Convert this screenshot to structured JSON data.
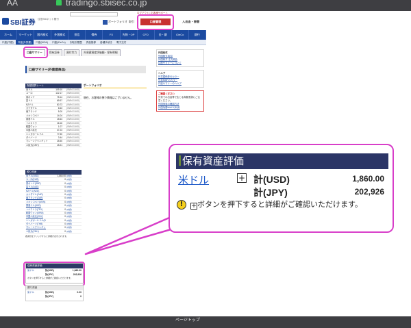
{
  "browser": {
    "aa_label": "AA",
    "url": "tradingo.sbisec.co.jp",
    "bottom_right_label": "ページトップ"
  },
  "header": {
    "logo": "SBI証券",
    "logo_sub": "住信SBIネット銀行",
    "top_links": "ログアウト | お客様サポート",
    "portfolio_label": "ポートフォリオ",
    "torihiki_label": "取引",
    "koza_kanri_label": "口座管理",
    "nyushukkin_label": "入出金・振替"
  },
  "nav": {
    "items": [
      "ホーム",
      "マーケット",
      "国内株式",
      "外国株式",
      "投信",
      "債券",
      "FX",
      "先物・OP",
      "CFD",
      "金・銀",
      "iDeCo",
      "銀行"
    ],
    "sub_items": [
      "口座(円建)",
      "口座(外貨建)",
      "口座(NISA)",
      "口座(iDeCo)",
      "お取引履歴",
      "資産推移",
      "各種手続き",
      "電子交付"
    ]
  },
  "tabs": {
    "items": [
      "口座サマリー",
      "保有証券",
      "買付余力",
      "外貨建資産評価額・保有明細"
    ],
    "active_index": 0
  },
  "summary": {
    "title": "口座サマリー(外貨建商品)"
  },
  "rates": {
    "title": "為替換算レート",
    "rows": [
      {
        "name": "米ドル",
        "value": "109.10",
        "time": "(09/04 15:00)"
      },
      {
        "name": "ユーロ",
        "value": "122.17",
        "time": "(09/04 15:00)"
      },
      {
        "name": "英ポンド",
        "value": "75.14",
        "time": "(09/04 15:00)"
      },
      {
        "name": "豪ドル",
        "value": "69.97",
        "time": "(09/04 15:00)"
      },
      {
        "name": "NZドル",
        "value": "80.73",
        "time": "(09/04 15:00)"
      },
      {
        "name": "カナダドル",
        "value": "6.63",
        "time": "(09/04 15:00)"
      },
      {
        "name": "南アランド",
        "value": "5.00",
        "time": "(09/04 15:00)"
      },
      {
        "name": "メキシコペソ",
        "value": "14.04",
        "time": "(09/04 15:00)"
      },
      {
        "name": "香港ドル",
        "value": "15.64",
        "time": "(09/04 15:00)"
      },
      {
        "name": "トルコリラ",
        "value": "16.16",
        "time": "(09/04 15:00)"
      },
      {
        "name": "韓国ウォン",
        "value": "1.07",
        "time": "(09/04 15:00)"
      },
      {
        "name": "中国人民元",
        "value": "47.23",
        "time": "(09/04 15:00)"
      },
      {
        "name": "シンガポールドル",
        "value": "77.50",
        "time": "(09/04 15:00)"
      },
      {
        "name": "タイバーツ",
        "value": "3.44",
        "time": "(09/04 15:00)"
      },
      {
        "name": "マレーシアリンギット",
        "value": "25.50",
        "time": "(09/04 15:00)"
      },
      {
        "name": "人民元(CNH)",
        "value": "15.21",
        "time": "(09/04 15:00)"
      }
    ]
  },
  "portfolio": {
    "title": "ポートフォリオ",
    "message": "現在、お客様の預り情報はございません。"
  },
  "holdings": {
    "title": "預り資産",
    "rows": [
      {
        "name": "米ドル(USD)",
        "value": "1,860.00",
        "link": "(内訳)"
      },
      {
        "name": "ユーロ(EUR)",
        "value": "0",
        "link": "(内訳)"
      },
      {
        "name": "英ポンド(GBP)",
        "value": "0",
        "link": "(内訳)"
      },
      {
        "name": "豪ドル(AUD)",
        "value": "0",
        "link": "(内訳)"
      },
      {
        "name": "NZドル(NZD)",
        "value": "0",
        "link": "(内訳)"
      },
      {
        "name": "カナダドル(CAD)",
        "value": "0",
        "link": "(内訳)"
      },
      {
        "name": "南アランド(ZAR)",
        "value": "0",
        "link": "(内訳)"
      },
      {
        "name": "メキシコペソ(MXN)",
        "value": "0",
        "link": "(内訳)"
      },
      {
        "name": "香港ドル(HKD)",
        "value": "0",
        "link": "(内訳)"
      },
      {
        "name": "トルコリラ(TRY)",
        "value": "0",
        "link": "(内訳)"
      },
      {
        "name": "韓国ウォン(KRW)",
        "value": "0",
        "link": "(内訳)"
      },
      {
        "name": "中国人民元(CNY)",
        "value": "0",
        "link": "(内訳)"
      },
      {
        "name": "シンガポールドル(SGD)",
        "value": "0",
        "link": "(内訳)"
      },
      {
        "name": "タイバーツ(THB)",
        "value": "0",
        "link": "(内訳)"
      },
      {
        "name": "マレーシアリンギット(MYR)",
        "value": "0",
        "link": "(内訳)"
      },
      {
        "name": "人民元(CNH)",
        "value": "0",
        "link": "(内訳)"
      }
    ],
    "note": "各通貨をクリックすると詳細が表示されます。"
  },
  "small_eval": {
    "title": "保有資産評価",
    "currency": "米ドル",
    "usd_label": "計(USD)",
    "usd_value": "1,860.00",
    "jpy_label": "計(JPY)",
    "jpy_value": "202,926",
    "note": "ボタンを押下すると詳細がご確認いただけます。"
  },
  "small_tax": {
    "title": "預り資産",
    "line1_left": "米ドル",
    "line1_mid": "計(USD)",
    "line1_right": "0.00",
    "line2_mid": "計(JPY)",
    "line2_right": "0"
  },
  "sidebar": {
    "box1_title": "外国株式",
    "box1_links": [
      "外国株式 取引",
      "外国株式 注文照会",
      "口座サマリーについて"
    ],
    "box2_title": "ヘルプ",
    "box2_links": [
      "外貨建債券のカラー",
      "外貨MMFのカラー",
      "口座サマリーのヘルプ"
    ],
    "warn_title": "ご確認ください",
    "warn_text": "外貨での出金等で生じる為替差損にご注意ください。",
    "warn_links": [
      "外国債券の確認方法",
      "外国為替MMFの利用"
    ]
  },
  "callout": {
    "title": "保有資産評価",
    "currency": "米ドル",
    "usd_label": "計(USD)",
    "usd_value": "1,860.00",
    "jpy_label": "計(JPY)",
    "jpy_value": "202,926",
    "note_prefix": "",
    "note": "ボタンを押下すると詳細がご確認いただけます。",
    "border_color": "#d83ec9",
    "header_color": "#2b3566"
  }
}
